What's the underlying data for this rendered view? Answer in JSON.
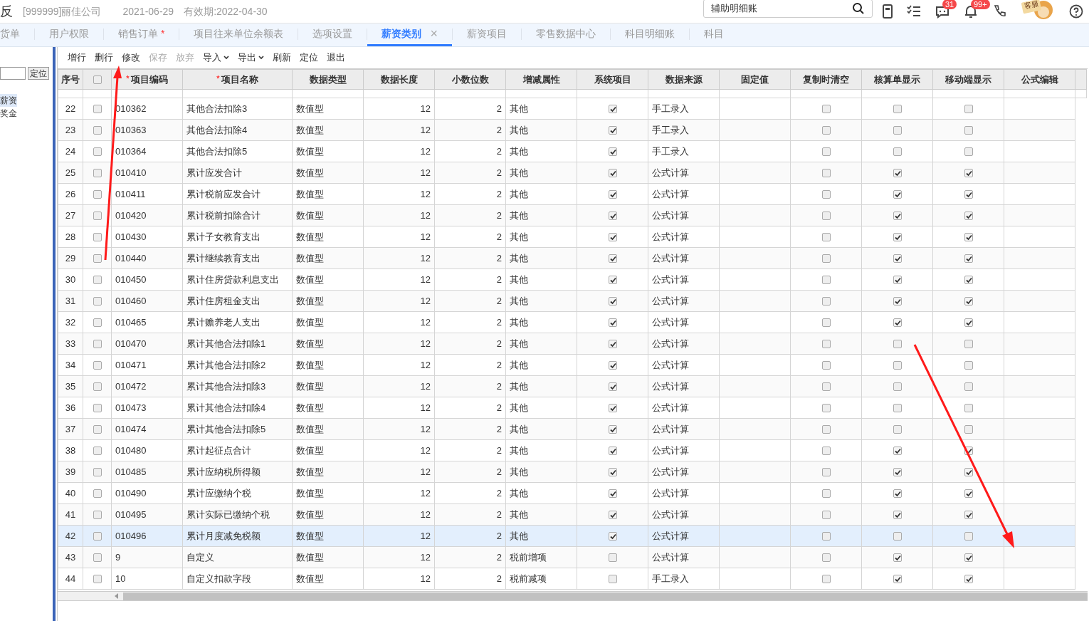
{
  "header": {
    "logo_fragment": "反",
    "company": "[999999]丽佳公司",
    "date": "2021-06-29",
    "validity": "有效期:2022-04-30",
    "search": {
      "value": "辅助明细账"
    },
    "badges": [
      {
        "kind": "chat",
        "count": "31"
      },
      {
        "kind": "bell",
        "count": "99+"
      }
    ],
    "mascot_sign": "客服"
  },
  "tabs": [
    {
      "label": "货单",
      "selected": false
    },
    {
      "label": "用户权限",
      "selected": false
    },
    {
      "label": "销售订单",
      "mark": "*",
      "selected": false
    },
    {
      "label": "项目往来单位余额表",
      "selected": false
    },
    {
      "label": "选项设置",
      "selected": false
    },
    {
      "label": "薪资类别",
      "selected": true,
      "close": "×"
    },
    {
      "label": "薪资项目",
      "selected": false
    },
    {
      "label": "零售数据中心",
      "selected": false
    },
    {
      "label": "科目明细账",
      "selected": false
    },
    {
      "label": "科目",
      "selected": false
    }
  ],
  "sidebar": {
    "locate_button": "定位",
    "items": [
      {
        "label": "薪资",
        "selected": true
      },
      {
        "label": "奖金",
        "selected": false
      }
    ]
  },
  "toolbar": [
    {
      "label": "增行",
      "disabled": false
    },
    {
      "label": "删行",
      "disabled": false
    },
    {
      "label": "修改",
      "disabled": false
    },
    {
      "label": "保存",
      "disabled": true
    },
    {
      "label": "放弃",
      "disabled": true
    },
    {
      "label": "导入",
      "disabled": false,
      "dropdown": true
    },
    {
      "label": "导出",
      "disabled": false,
      "dropdown": true
    },
    {
      "label": "刷新",
      "disabled": false
    },
    {
      "label": "定位",
      "disabled": false
    },
    {
      "label": "退出",
      "disabled": false
    }
  ],
  "table": {
    "columns": [
      {
        "label": "序号"
      },
      {
        "kind": "checkbox",
        "checked": false
      },
      {
        "label": "项目编码",
        "mark": "*"
      },
      {
        "label": "项目名称",
        "mark": "*"
      },
      {
        "label": "数据类型"
      },
      {
        "label": "数据长度"
      },
      {
        "label": "小数位数"
      },
      {
        "label": "增减属性"
      },
      {
        "label": "系统项目"
      },
      {
        "label": "数据来源"
      },
      {
        "label": "固定值"
      },
      {
        "label": "复制时清空"
      },
      {
        "label": "核算单显示"
      },
      {
        "label": "移动端显示"
      },
      {
        "label": "公式编辑"
      }
    ],
    "rows": [
      {
        "no": "22",
        "checked": false,
        "code": "010362",
        "name": "其他合法扣除3",
        "type": "数值型",
        "length": "12",
        "decimals": "2",
        "attr": "其他",
        "system": true,
        "source": "手工录入",
        "copy_clear": false,
        "account_show": false,
        "mobile_show": false,
        "selected": false
      },
      {
        "no": "23",
        "checked": false,
        "code": "010363",
        "name": "其他合法扣除4",
        "type": "数值型",
        "length": "12",
        "decimals": "2",
        "attr": "其他",
        "system": true,
        "source": "手工录入",
        "copy_clear": false,
        "account_show": false,
        "mobile_show": false,
        "selected": false
      },
      {
        "no": "24",
        "checked": false,
        "code": "010364",
        "name": "其他合法扣除5",
        "type": "数值型",
        "length": "12",
        "decimals": "2",
        "attr": "其他",
        "system": true,
        "source": "手工录入",
        "copy_clear": false,
        "account_show": false,
        "mobile_show": false,
        "selected": false
      },
      {
        "no": "25",
        "checked": false,
        "code": "010410",
        "name": "累计应发合计",
        "type": "数值型",
        "length": "12",
        "decimals": "2",
        "attr": "其他",
        "system": true,
        "source": "公式计算",
        "copy_clear": false,
        "account_show": true,
        "mobile_show": true,
        "selected": false
      },
      {
        "no": "26",
        "checked": false,
        "code": "010411",
        "name": "累计税前应发合计",
        "type": "数值型",
        "length": "12",
        "decimals": "2",
        "attr": "其他",
        "system": true,
        "source": "公式计算",
        "copy_clear": false,
        "account_show": true,
        "mobile_show": true,
        "selected": false
      },
      {
        "no": "27",
        "checked": false,
        "code": "010420",
        "name": "累计税前扣除合计",
        "type": "数值型",
        "length": "12",
        "decimals": "2",
        "attr": "其他",
        "system": true,
        "source": "公式计算",
        "copy_clear": false,
        "account_show": true,
        "mobile_show": true,
        "selected": false
      },
      {
        "no": "28",
        "checked": false,
        "code": "010430",
        "name": "累计子女教育支出",
        "type": "数值型",
        "length": "12",
        "decimals": "2",
        "attr": "其他",
        "system": true,
        "source": "公式计算",
        "copy_clear": false,
        "account_show": true,
        "mobile_show": true,
        "selected": false
      },
      {
        "no": "29",
        "checked": false,
        "code": "010440",
        "name": "累计继续教育支出",
        "type": "数值型",
        "length": "12",
        "decimals": "2",
        "attr": "其他",
        "system": true,
        "source": "公式计算",
        "copy_clear": false,
        "account_show": true,
        "mobile_show": true,
        "selected": false
      },
      {
        "no": "30",
        "checked": false,
        "code": "010450",
        "name": "累计住房贷款利息支出",
        "type": "数值型",
        "length": "12",
        "decimals": "2",
        "attr": "其他",
        "system": true,
        "source": "公式计算",
        "copy_clear": false,
        "account_show": true,
        "mobile_show": true,
        "selected": false
      },
      {
        "no": "31",
        "checked": false,
        "code": "010460",
        "name": "累计住房租金支出",
        "type": "数值型",
        "length": "12",
        "decimals": "2",
        "attr": "其他",
        "system": true,
        "source": "公式计算",
        "copy_clear": false,
        "account_show": true,
        "mobile_show": true,
        "selected": false
      },
      {
        "no": "32",
        "checked": false,
        "code": "010465",
        "name": "累计赡养老人支出",
        "type": "数值型",
        "length": "12",
        "decimals": "2",
        "attr": "其他",
        "system": true,
        "source": "公式计算",
        "copy_clear": false,
        "account_show": true,
        "mobile_show": true,
        "selected": false
      },
      {
        "no": "33",
        "checked": false,
        "code": "010470",
        "name": "累计其他合法扣除1",
        "type": "数值型",
        "length": "12",
        "decimals": "2",
        "attr": "其他",
        "system": true,
        "source": "公式计算",
        "copy_clear": false,
        "account_show": false,
        "mobile_show": false,
        "selected": false
      },
      {
        "no": "34",
        "checked": false,
        "code": "010471",
        "name": "累计其他合法扣除2",
        "type": "数值型",
        "length": "12",
        "decimals": "2",
        "attr": "其他",
        "system": true,
        "source": "公式计算",
        "copy_clear": false,
        "account_show": false,
        "mobile_show": false,
        "selected": false
      },
      {
        "no": "35",
        "checked": false,
        "code": "010472",
        "name": "累计其他合法扣除3",
        "type": "数值型",
        "length": "12",
        "decimals": "2",
        "attr": "其他",
        "system": true,
        "source": "公式计算",
        "copy_clear": false,
        "account_show": false,
        "mobile_show": false,
        "selected": false
      },
      {
        "no": "36",
        "checked": false,
        "code": "010473",
        "name": "累计其他合法扣除4",
        "type": "数值型",
        "length": "12",
        "decimals": "2",
        "attr": "其他",
        "system": true,
        "source": "公式计算",
        "copy_clear": false,
        "account_show": false,
        "mobile_show": false,
        "selected": false
      },
      {
        "no": "37",
        "checked": false,
        "code": "010474",
        "name": "累计其他合法扣除5",
        "type": "数值型",
        "length": "12",
        "decimals": "2",
        "attr": "其他",
        "system": true,
        "source": "公式计算",
        "copy_clear": false,
        "account_show": false,
        "mobile_show": false,
        "selected": false
      },
      {
        "no": "38",
        "checked": false,
        "code": "010480",
        "name": "累计起征点合计",
        "type": "数值型",
        "length": "12",
        "decimals": "2",
        "attr": "其他",
        "system": true,
        "source": "公式计算",
        "copy_clear": false,
        "account_show": true,
        "mobile_show": true,
        "selected": false
      },
      {
        "no": "39",
        "checked": false,
        "code": "010485",
        "name": "累计应纳税所得额",
        "type": "数值型",
        "length": "12",
        "decimals": "2",
        "attr": "其他",
        "system": true,
        "source": "公式计算",
        "copy_clear": false,
        "account_show": true,
        "mobile_show": true,
        "selected": false
      },
      {
        "no": "40",
        "checked": false,
        "code": "010490",
        "name": "累计应缴纳个税",
        "type": "数值型",
        "length": "12",
        "decimals": "2",
        "attr": "其他",
        "system": true,
        "source": "公式计算",
        "copy_clear": false,
        "account_show": true,
        "mobile_show": true,
        "selected": false
      },
      {
        "no": "41",
        "checked": false,
        "code": "010495",
        "name": "累计实际已缴纳个税",
        "type": "数值型",
        "length": "12",
        "decimals": "2",
        "attr": "其他",
        "system": true,
        "source": "公式计算",
        "copy_clear": false,
        "account_show": true,
        "mobile_show": true,
        "selected": false
      },
      {
        "no": "42",
        "checked": false,
        "code": "010496",
        "name": "累计月度减免税额",
        "type": "数值型",
        "length": "12",
        "decimals": "2",
        "attr": "其他",
        "system": true,
        "source": "公式计算",
        "copy_clear": false,
        "account_show": false,
        "mobile_show": false,
        "selected": true
      },
      {
        "no": "43",
        "checked": false,
        "code": "9",
        "name": "自定义",
        "type": "数值型",
        "length": "12",
        "decimals": "2",
        "attr": "税前增项",
        "system": false,
        "source": "公式计算",
        "copy_clear": false,
        "account_show": true,
        "mobile_show": true,
        "selected": false
      },
      {
        "no": "44",
        "checked": false,
        "code": "10",
        "name": "自定义扣款字段",
        "type": "数值型",
        "length": "12",
        "decimals": "2",
        "attr": "税前减项",
        "system": false,
        "source": "手工录入",
        "copy_clear": false,
        "account_show": true,
        "mobile_show": true,
        "selected": false
      }
    ]
  }
}
